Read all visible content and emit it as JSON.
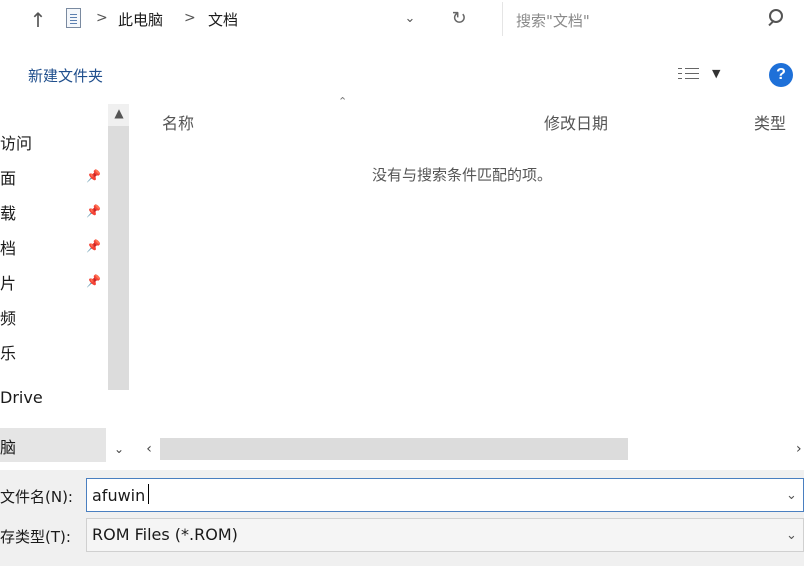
{
  "address": {
    "breadcrumb": [
      "此电脑",
      "文档"
    ],
    "separator": ">",
    "search_placeholder": "搜索\"文档\""
  },
  "toolbar": {
    "new_folder_label": "新建文件夹",
    "help_label": "?"
  },
  "nav": {
    "items": [
      {
        "label": "访问",
        "pinned": false
      },
      {
        "label": "面",
        "pinned": true
      },
      {
        "label": "载",
        "pinned": true
      },
      {
        "label": "档",
        "pinned": true
      },
      {
        "label": "片",
        "pinned": true
      },
      {
        "label": "频",
        "pinned": false
      },
      {
        "label": "乐",
        "pinned": false
      },
      {
        "label": "Drive",
        "pinned": false
      },
      {
        "label": "脑",
        "pinned": false,
        "selected": true
      }
    ]
  },
  "list": {
    "columns": [
      "名称",
      "修改日期",
      "类型"
    ],
    "empty_message": "没有与搜索条件匹配的项。"
  },
  "bottom": {
    "filename_label": "文件名(N):",
    "filename_value": "afuwin",
    "filetype_label": "存类型(T):",
    "filetype_value": "ROM Files (*.ROM)"
  },
  "colors": {
    "accent": "#1e70d8",
    "link": "#1f4e8c",
    "focus_border": "#4a7fc0"
  }
}
